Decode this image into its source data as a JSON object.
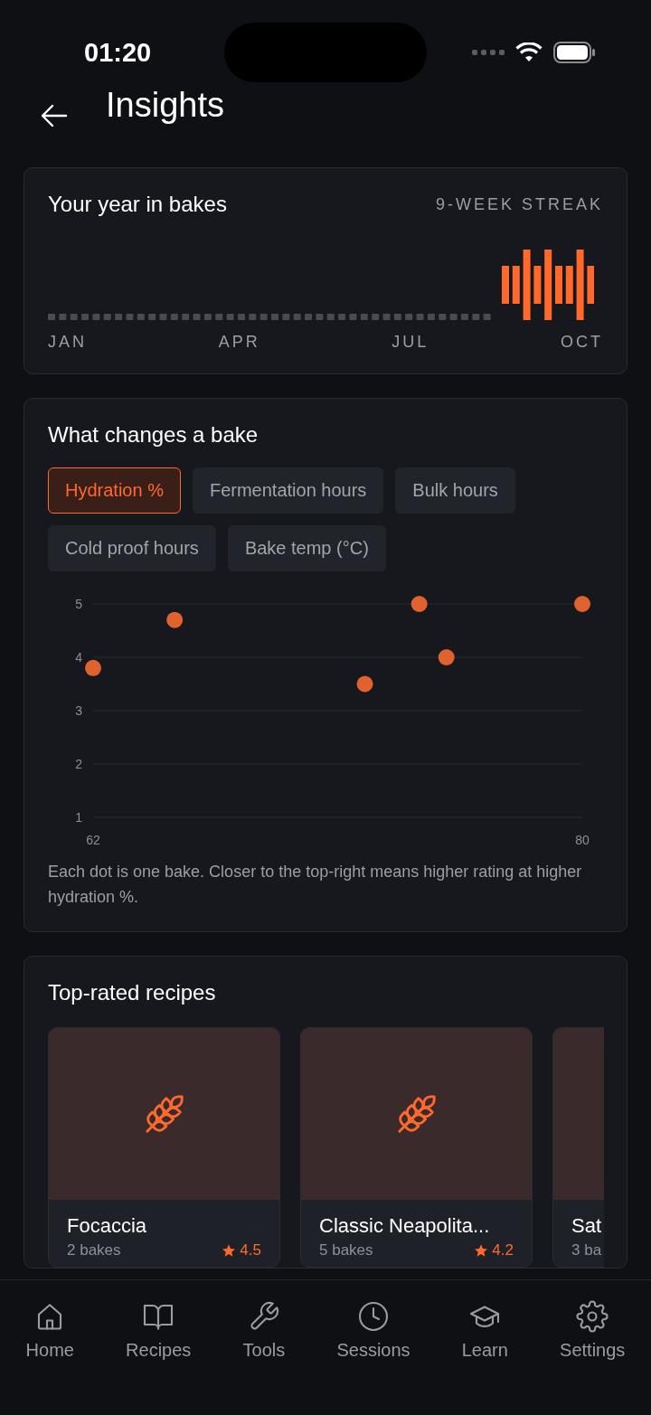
{
  "status_bar": {
    "time": "01:20"
  },
  "header": {
    "title": "Insights"
  },
  "year_card": {
    "title": "Your year in bakes",
    "streak": "9-WEEK STREAK",
    "months": [
      "JAN",
      "APR",
      "JUL",
      "OCT"
    ]
  },
  "changes_card": {
    "title": "What changes a bake",
    "filters": [
      {
        "label": "Hydration %",
        "selected": true
      },
      {
        "label": "Fermentation hours",
        "selected": false
      },
      {
        "label": "Bulk hours",
        "selected": false
      },
      {
        "label": "Cold proof hours",
        "selected": false
      },
      {
        "label": "Bake temp (°C)",
        "selected": false
      }
    ],
    "chart_data": {
      "type": "scatter",
      "x": [
        62,
        65,
        72,
        74,
        75,
        80
      ],
      "series": [
        {
          "color": "#e0622e",
          "values": [
            3.8,
            4.7,
            3.5,
            5,
            4,
            5
          ]
        }
      ],
      "xlim": [
        62,
        80
      ],
      "ylim": [
        1,
        5
      ],
      "xticks": [
        62,
        80
      ],
      "yticks": [
        1,
        2,
        3,
        4,
        5
      ],
      "grid": true
    },
    "caption": "Each dot is one bake. Closer to the top-right means higher rating at higher hydration %."
  },
  "recipes_card": {
    "title": "Top-rated recipes",
    "recipes": [
      {
        "name": "Focaccia",
        "bakes": "2 bakes",
        "rating": "4.5"
      },
      {
        "name": "Classic Neapolita...",
        "bakes": "5 bakes",
        "rating": "4.2"
      },
      {
        "name": "Sat",
        "bakes": "3 ba"
      }
    ]
  },
  "tab_bar": [
    {
      "label": "Home",
      "kind": "home"
    },
    {
      "label": "Recipes",
      "kind": "recipes"
    },
    {
      "label": "Tools",
      "kind": "tools"
    },
    {
      "label": "Sessions",
      "kind": "sessions"
    },
    {
      "label": "Learn",
      "kind": "learn"
    },
    {
      "label": "Settings",
      "kind": "settings"
    }
  ]
}
